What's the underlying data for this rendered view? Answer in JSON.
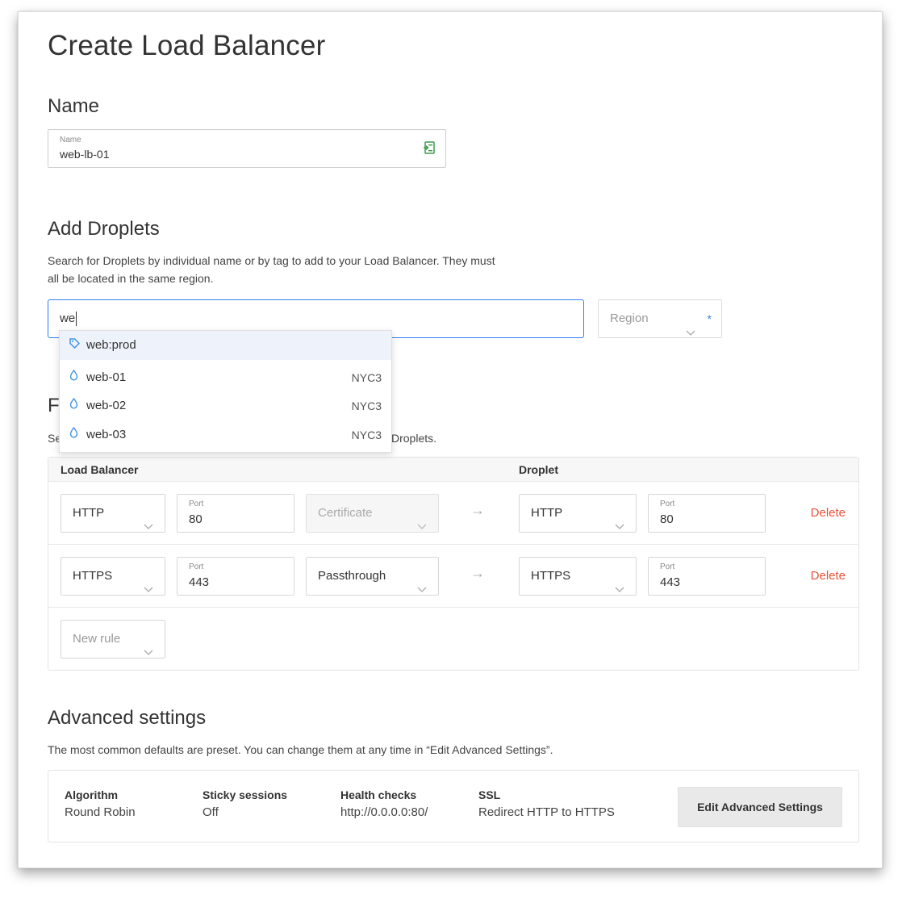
{
  "page_title": "Create Load Balancer",
  "name_section": {
    "title": "Name",
    "field_label": "Name",
    "field_value": "web-lb-01"
  },
  "droplets_section": {
    "title": "Add Droplets",
    "description_line1": "Search for Droplets by individual name or by tag to add to your Load Balancer. They must",
    "description_line2": "all be located in the same region.",
    "search_value": "we",
    "region_placeholder": "Region",
    "required_mark": "*",
    "suggestions": [
      {
        "label": "web:prod",
        "region": "",
        "icon": "tag-icon"
      },
      {
        "label": "web-01",
        "region": "NYC3",
        "icon": "droplet-icon"
      },
      {
        "label": "web-02",
        "region": "NYC3",
        "icon": "droplet-icon"
      },
      {
        "label": "web-03",
        "region": "NYC3",
        "icon": "droplet-icon"
      }
    ]
  },
  "forwarding_section": {
    "title_visible": "F",
    "desc_left": "Se",
    "desc_right": "Droplets.",
    "header_lb": "Load Balancer",
    "header_droplet": "Droplet",
    "port_label": "Port",
    "arrow": "→",
    "delete_label": "Delete",
    "rules": [
      {
        "lb_protocol": "HTTP",
        "lb_port": "80",
        "certificate": "Certificate",
        "certificate_disabled": true,
        "droplet_protocol": "HTTP",
        "droplet_port": "80"
      },
      {
        "lb_protocol": "HTTPS",
        "lb_port": "443",
        "certificate": "Passthrough",
        "certificate_disabled": false,
        "droplet_protocol": "HTTPS",
        "droplet_port": "443"
      }
    ],
    "new_rule_placeholder": "New rule"
  },
  "advanced_section": {
    "title": "Advanced settings",
    "description": "The most common defaults are preset. You can change them at any time in “Edit Advanced Settings”.",
    "items": [
      {
        "key": "Algorithm",
        "value": "Round Robin"
      },
      {
        "key": "Sticky sessions",
        "value": "Off"
      },
      {
        "key": "Health checks",
        "value": "http://0.0.0.0:80/"
      },
      {
        "key": "SSL",
        "value": "Redirect HTTP to HTTPS"
      }
    ],
    "edit_button": "Edit Advanced Settings"
  },
  "colors": {
    "accent": "#2f7ef7",
    "danger": "#e8533a",
    "icon_blue": "#3a8ee6"
  }
}
